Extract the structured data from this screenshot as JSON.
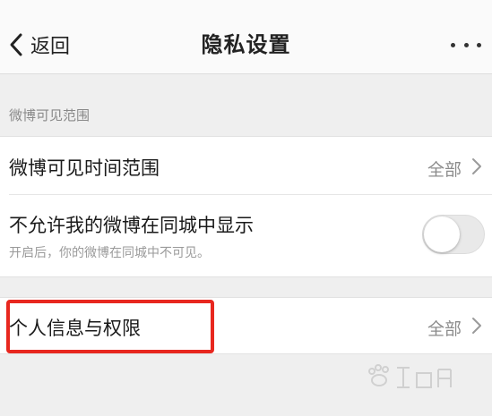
{
  "nav": {
    "back_label": "返回",
    "title": "隐私设置"
  },
  "section": {
    "header": "微博可见范围"
  },
  "rows": {
    "visible_time": {
      "title": "微博可见时间范围",
      "value": "全部"
    },
    "same_city": {
      "title": "不允许我的微博在同城中显示",
      "subtitle": "开启后，你的微博在同城中不可见。",
      "toggle_on": false
    },
    "personal_info": {
      "title": "个人信息与权限",
      "value": "全部"
    }
  },
  "colors": {
    "highlight": "#e8271f",
    "toggle_off": "#e9e9e9"
  }
}
